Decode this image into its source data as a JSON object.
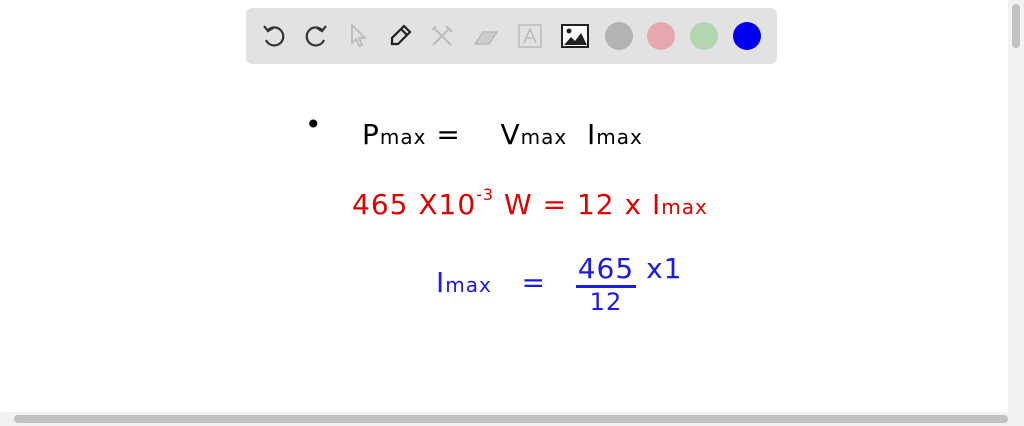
{
  "toolbar": {
    "tools": [
      "undo-icon",
      "redo-icon",
      "select-icon",
      "pen-icon",
      "tools-icon",
      "eraser-icon",
      "text-icon",
      "image-icon"
    ],
    "colors": [
      "#b3b3b3",
      "#e6a8ae",
      "#b3d6b0",
      "#0000ee"
    ]
  },
  "canvas": {
    "bullet": "•",
    "line1": {
      "p": "P",
      "p_sub": "max",
      "eq": "=",
      "v": "V",
      "v_sub": "max",
      "i": "I",
      "i_sub": "max",
      "color": "#000000"
    },
    "line2": {
      "lhs": "465 X10",
      "exp": "-3",
      "unit": "W = 12 x I",
      "i_sub": "max",
      "color": "#e00000"
    },
    "line3": {
      "i": "I",
      "i_sub": "max",
      "eq": "=",
      "num": "465",
      "den": "12",
      "mult": "x1",
      "color": "#1a1ae6"
    }
  }
}
